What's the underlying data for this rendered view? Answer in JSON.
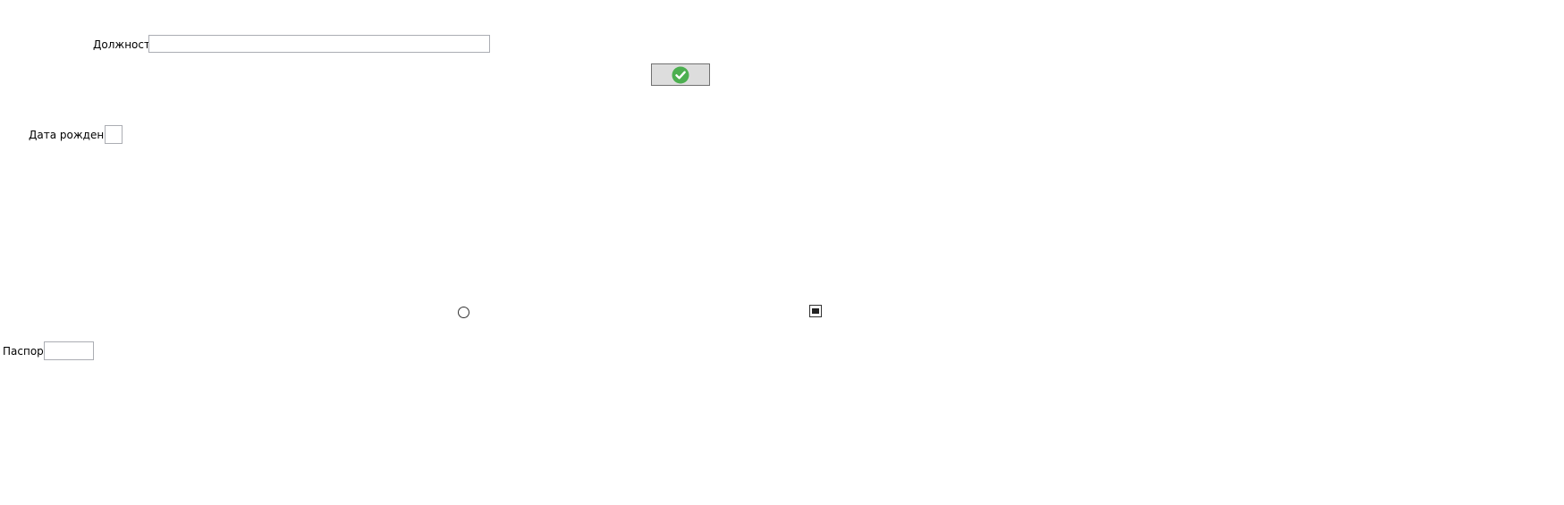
{
  "form": {
    "position_label": "Должность",
    "position_value": "",
    "birthdate_label": "Дата рождения",
    "birthdate_value": "",
    "passport_label": "Паспорт",
    "passport_value": ""
  },
  "controls": {
    "ok_button_icon": "check-circle-icon",
    "ok_button_icon_color": "#4caf50",
    "radio_checked": false,
    "checkbox_state": "indeterminate"
  }
}
